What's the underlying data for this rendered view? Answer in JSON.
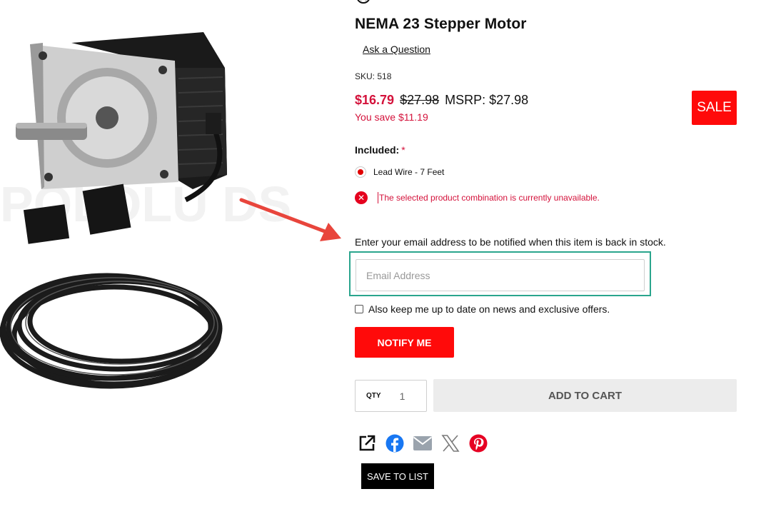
{
  "product": {
    "title": "NEMA 23 Stepper Motor",
    "ask_question": "Ask a Question",
    "sku": "SKU: 518"
  },
  "pricing": {
    "sale_price": "$16.79",
    "original_price": "$27.98",
    "msrp": "MSRP: $27.98",
    "you_save": "You save $11.19",
    "badge": "SALE",
    "sale_color": "#d4123b"
  },
  "options": {
    "included_label": "Included:",
    "required_mark": "*",
    "choices": [
      {
        "label": "Lead Wire - 7 Feet",
        "selected": true
      }
    ]
  },
  "error": {
    "message": "The selected product combination is currently unavailable."
  },
  "notify": {
    "prompt": "Enter your email address to be notified when this item is back in stock.",
    "email_placeholder": "Email Address",
    "email_value": "",
    "opt_in_label": "Also keep me up to date on news and exclusive offers.",
    "opt_in_checked": false,
    "button_label": "NOTIFY ME"
  },
  "cart": {
    "qty_label": "QTY",
    "qty_value": "1",
    "add_to_cart_label": "ADD TO CART"
  },
  "share": {
    "icons": [
      "share-icon",
      "facebook-icon",
      "email-icon",
      "x-icon",
      "pinterest-icon"
    ]
  },
  "save_to_list": "SAVE TO LIST",
  "colors": {
    "accent_red": "#ff0a0a",
    "highlight_teal": "#2aa58d",
    "annotation_arrow": "#e8453c"
  }
}
